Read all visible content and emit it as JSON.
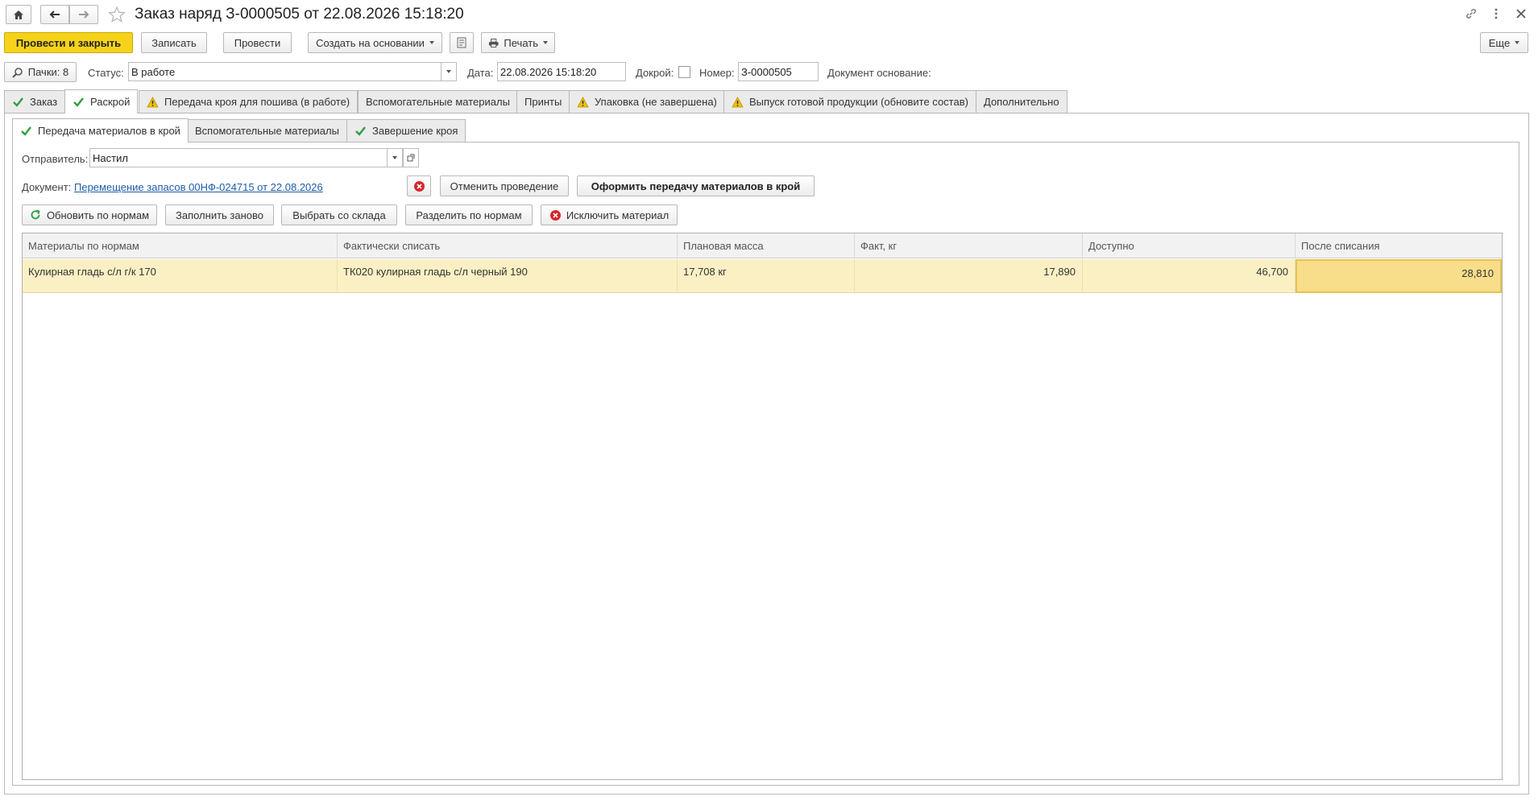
{
  "window": {
    "title": "Заказ наряд З-0000505 от 22.08.2026 15:18:20"
  },
  "toolbar": {
    "post_close": "Провести и закрыть",
    "save": "Записать",
    "post": "Провести",
    "create_based": "Создать на основании",
    "print": "Печать",
    "more": "Еще"
  },
  "header": {
    "bundles": "Пачки: 8",
    "status_label": "Статус:",
    "status_value": "В работе",
    "date_label": "Дата:",
    "date_value": "22.08.2026 15:18:20",
    "recut_label": "Докрой:",
    "recut_checked": false,
    "number_label": "Номер:",
    "number_value": "З-0000505",
    "base_doc_label": "Документ основание:"
  },
  "tabs": [
    {
      "label": "Заказ",
      "icon": "check-icon"
    },
    {
      "label": "Раскрой",
      "icon": "check-icon"
    },
    {
      "label": "Передача кроя для пошива (в работе)",
      "icon": "warning-icon"
    },
    {
      "label": "Вспомогательные материалы",
      "icon": ""
    },
    {
      "label": "Принты",
      "icon": ""
    },
    {
      "label": "Упаковка (не завершена)",
      "icon": "warning-icon"
    },
    {
      "label": "Выпуск готовой продукции (обновите состав)",
      "icon": "warning-icon"
    },
    {
      "label": "Дополнительно",
      "icon": ""
    }
  ],
  "subtabs": [
    {
      "label": "Передача материалов в крой",
      "icon": "check-icon"
    },
    {
      "label": "Вспомогательные материалы",
      "icon": ""
    },
    {
      "label": "Завершение кроя",
      "icon": "check-icon"
    }
  ],
  "sender": {
    "label": "Отправитель:",
    "value": "Настил"
  },
  "document": {
    "label": "Документ:",
    "link": "Перемещение запасов 00НФ-024715 от 22.08.2026",
    "cancel_posting": "Отменить проведение",
    "make_transfer": "Оформить передачу материалов в крой"
  },
  "actions": {
    "update_norms": "Обновить по нормам",
    "refill": "Заполнить заново",
    "pick_warehouse": "Выбрать со склада",
    "split_norms": "Разделить по нормам",
    "exclude": "Исключить материал"
  },
  "table": {
    "columns": [
      "Материалы по нормам",
      "Фактически списать",
      "Плановая масса",
      "Факт, кг",
      "Доступно",
      "После списания"
    ],
    "rows": [
      [
        "Кулирная гладь с/л г/к 170",
        "ТК020 кулирная гладь с/л черный 190",
        "17,708 кг",
        "17,890",
        "46,700",
        "28,810"
      ]
    ]
  },
  "colors": {
    "primary_button": "#f6d31a",
    "row_highlight": "#fbf0c4",
    "selected_cell": "#f8dd8a",
    "check": "#2e9e3e",
    "warning": "#f2c200",
    "error": "#d9262b",
    "link": "#1f5ca8"
  }
}
